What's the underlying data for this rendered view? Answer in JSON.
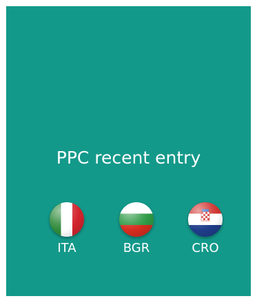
{
  "card": {
    "background": "#13998a",
    "title": "PPC recent entry"
  },
  "flags": [
    {
      "label": "ITA",
      "icon": "italy-flag-icon"
    },
    {
      "label": "BGR",
      "icon": "bulgaria-flag-icon"
    },
    {
      "label": "CRO",
      "icon": "croatia-flag-icon"
    }
  ],
  "colors": {
    "text": "#ffffff",
    "italy": [
      "#2f8a3a",
      "#ffffff",
      "#d3242d"
    ],
    "bulgaria": [
      "#ffffff",
      "#2e9a46",
      "#d62d1f"
    ],
    "croatia": [
      "#d0312d",
      "#ffffff",
      "#1f3d8a"
    ]
  }
}
